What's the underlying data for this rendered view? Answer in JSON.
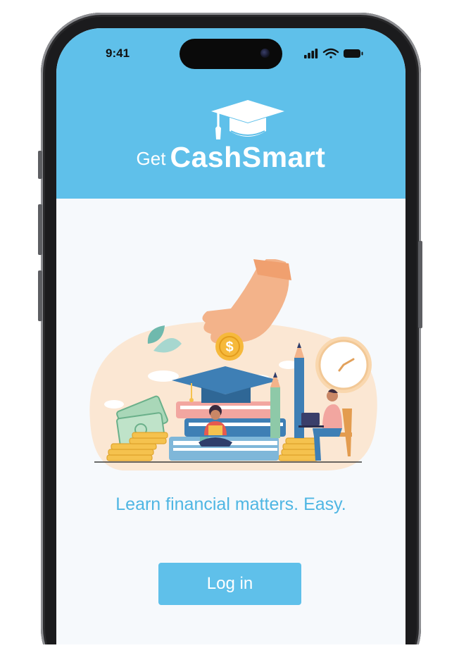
{
  "status_bar": {
    "time": "9:41",
    "icons": [
      "cellular-signal-icon",
      "wifi-icon",
      "battery-icon"
    ]
  },
  "header": {
    "logo_icon": "graduation-cap-icon",
    "logo_prefix": "Get",
    "logo_name": "CashSmart"
  },
  "main": {
    "illustration": "hand-dropping-coin-onto-books-illustration",
    "coin_symbol": "$",
    "tagline": "Learn financial matters. Easy.",
    "login_label": "Log in"
  },
  "colors": {
    "brand_blue": "#5fc0ea",
    "tagline_blue": "#4fb6e3",
    "background": "#f6f9fc",
    "phone_frame": "#1b1b1d"
  }
}
